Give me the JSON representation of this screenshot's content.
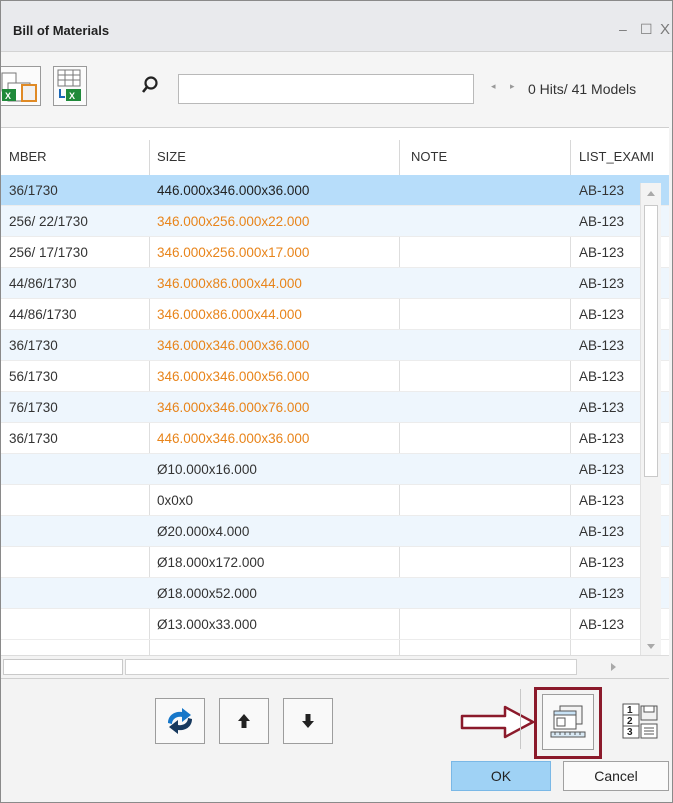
{
  "window": {
    "title": "Bill of Materials",
    "controls": {
      "minimize": "–",
      "maximize": "☐",
      "close": "X"
    }
  },
  "toolbar": {
    "search": {
      "value": "",
      "placeholder": ""
    },
    "nav_arrows": "◂ ▸",
    "hits_label": "0 Hits/ 41 Models"
  },
  "table": {
    "columns": [
      "MBER",
      "SIZE",
      "NOTE",
      "LIST_EXAMI"
    ],
    "rows": [
      {
        "number": "36/1730",
        "size": "446.000x346.000x36.000",
        "note": "",
        "list": "AB-123",
        "size_color": "#222222"
      },
      {
        "number": "256/ 22/1730",
        "size": "346.000x256.000x22.000",
        "note": "",
        "list": "AB-123",
        "size_color": "#e8841a"
      },
      {
        "number": "256/ 17/1730",
        "size": "346.000x256.000x17.000",
        "note": "",
        "list": "AB-123",
        "size_color": "#e8841a"
      },
      {
        "number": "44/86/1730",
        "size": "346.000x86.000x44.000",
        "note": "",
        "list": "AB-123",
        "size_color": "#e8841a"
      },
      {
        "number": "44/86/1730",
        "size": "346.000x86.000x44.000",
        "note": "",
        "list": "AB-123",
        "size_color": "#e8841a"
      },
      {
        "number": "36/1730",
        "size": "346.000x346.000x36.000",
        "note": "",
        "list": "AB-123",
        "size_color": "#e8841a"
      },
      {
        "number": "56/1730",
        "size": "346.000x346.000x56.000",
        "note": "",
        "list": "AB-123",
        "size_color": "#e8841a"
      },
      {
        "number": "76/1730",
        "size": "346.000x346.000x76.000",
        "note": "",
        "list": "AB-123",
        "size_color": "#e8841a"
      },
      {
        "number": "36/1730",
        "size": "446.000x346.000x36.000",
        "note": "",
        "list": "AB-123",
        "size_color": "#e8841a"
      },
      {
        "number": "",
        "size": "Ø10.000x16.000",
        "note": "",
        "list": "AB-123",
        "size_color": "#333333"
      },
      {
        "number": "",
        "size": "0x0x0",
        "note": "",
        "list": "AB-123",
        "size_color": "#333333"
      },
      {
        "number": "",
        "size": "Ø20.000x4.000",
        "note": "",
        "list": "AB-123",
        "size_color": "#333333"
      },
      {
        "number": "",
        "size": "Ø18.000x172.000",
        "note": "",
        "list": "AB-123",
        "size_color": "#333333"
      },
      {
        "number": "",
        "size": "Ø18.000x52.000",
        "note": "",
        "list": "AB-123",
        "size_color": "#333333"
      },
      {
        "number": "",
        "size": "Ø13.000x33.000",
        "note": "",
        "list": "AB-123",
        "size_color": "#333333"
      }
    ]
  },
  "buttons": {
    "refresh_icon": "refresh-icon",
    "move_up_icon": "arrow-up-icon",
    "move_down_icon": "arrow-down-icon",
    "highlighted_icon": "bom-report-icon",
    "numbering_icon": "numbering-icon",
    "ok_label": "OK",
    "cancel_label": "Cancel"
  },
  "colors": {
    "selected_row": "#b7ddfa",
    "alt_row": "#eef6fd",
    "highlight_frame": "#8b1a2b",
    "arrow_outline": "#8b1a2b",
    "orange_text": "#e8841a"
  }
}
